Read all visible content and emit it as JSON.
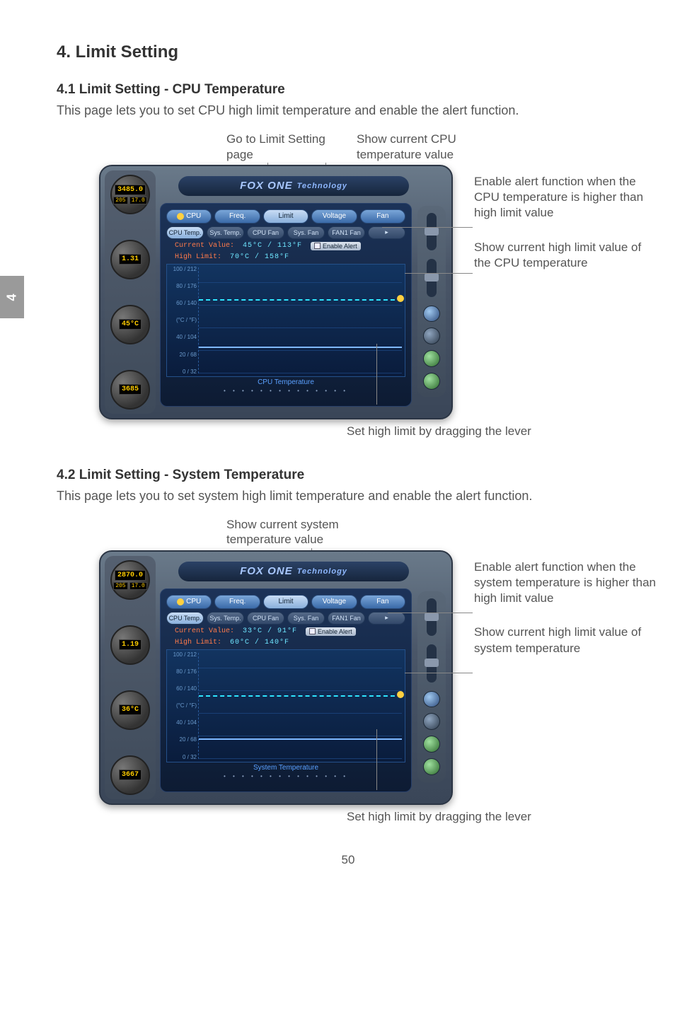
{
  "page_number": "50",
  "side_tab": "4",
  "section_title": "4. Limit Setting",
  "cpu": {
    "subtitle": "4.1 Limit Setting - CPU Temperature",
    "description": "This page lets you to set CPU high limit temperature and enable the alert function.",
    "callout_top_left": "Go to Limit Setting page",
    "callout_top_right": "Show current CPU temperature value",
    "callout_right_1": "Enable alert function when the CPU temperature is higher than high limit value",
    "callout_right_2": "Show current high limit value of the CPU temperature",
    "callout_bottom": "Set high limit by dragging the lever",
    "brand": "FOX ONE",
    "brand_sub": "Technology",
    "gauge_freq": "3485.0",
    "gauge_freq_sub1": "205",
    "gauge_freq_sub2": "17.0",
    "gauge_volt": "1.31",
    "gauge_temp": "45°C",
    "gauge_fan": "3685",
    "tab_cpu": "CPU",
    "tab_freq": "Freq.",
    "tab_limit": "Limit",
    "tab_voltage": "Voltage",
    "tab_fan": "Fan",
    "sub_cputemp": "CPU Temp.",
    "sub_systemp": "Sys. Temp.",
    "sub_cpufan": "CPU Fan",
    "sub_sysfan": "Sys. Fan",
    "sub_fan1": "FAN1 Fan",
    "current_label": "Current Value:",
    "current_value": "45°C / 113°F",
    "highlimit_label": "High Limit:",
    "highlimit_value": "70°C / 158°F",
    "enable_alert": "Enable Alert",
    "chart_title": "CPU Temperature",
    "yaxis": [
      "100 / 212",
      "80 / 176",
      "60 / 140",
      "(°C / °F)",
      "40 / 104",
      "20 / 68",
      "0 / 32"
    ]
  },
  "sys": {
    "subtitle": "4.2 Limit Setting - System Temperature",
    "description": "This page lets you to set system high limit temperature and enable the alert function.",
    "callout_top": "Show current system temperature value",
    "callout_right_1": "Enable alert function when the system temperature is higher than high limit value",
    "callout_right_2": "Show current high limit value of system temperature",
    "callout_bottom": "Set high limit by dragging the lever",
    "brand": "FOX ONE",
    "brand_sub": "Technology",
    "gauge_freq": "2870.0",
    "gauge_freq_sub1": "205",
    "gauge_freq_sub2": "17.0",
    "gauge_volt": "1.19",
    "gauge_temp": "36°C",
    "gauge_fan": "3667",
    "tab_cpu": "CPU",
    "tab_freq": "Freq.",
    "tab_limit": "Limit",
    "tab_voltage": "Voltage",
    "tab_fan": "Fan",
    "sub_cputemp": "CPU Temp.",
    "sub_systemp": "Sys. Temp.",
    "sub_cpufan": "CPU Fan",
    "sub_sysfan": "Sys. Fan",
    "sub_fan1": "FAN1 Fan",
    "current_label": "Current Value:",
    "current_value": "33°C / 91°F",
    "highlimit_label": "High Limit:",
    "highlimit_value": "60°C / 140°F",
    "enable_alert": "Enable Alert",
    "chart_title": "System Temperature",
    "yaxis": [
      "100 / 212",
      "80 / 176",
      "60 / 140",
      "(°C / °F)",
      "40 / 104",
      "20 / 68",
      "0 / 32"
    ]
  }
}
